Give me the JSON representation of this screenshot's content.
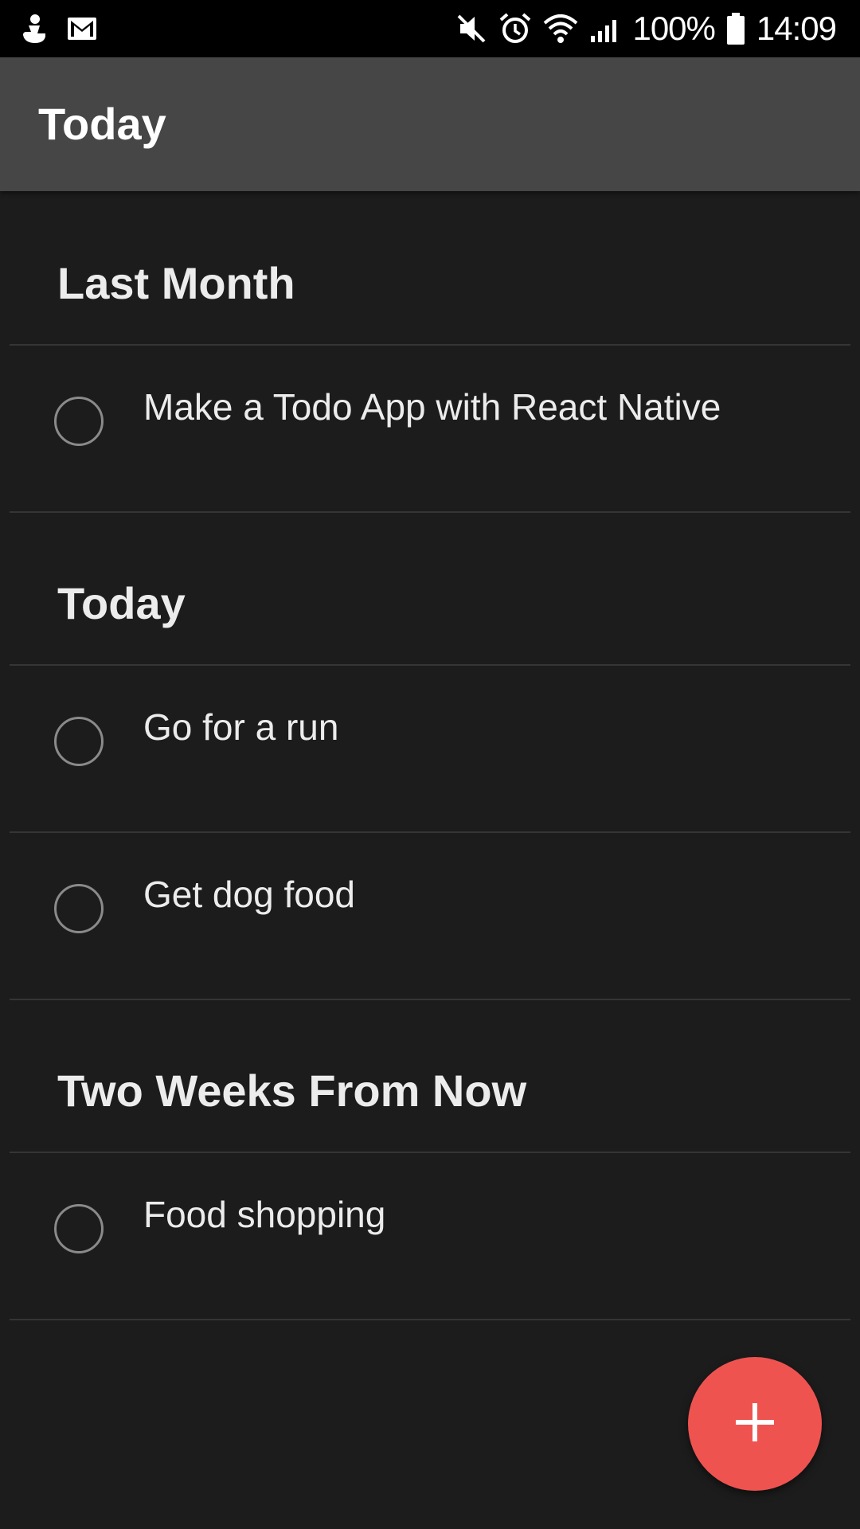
{
  "status_bar": {
    "battery_text": "100%",
    "time": "14:09",
    "left_icons": [
      "notification-icon",
      "gmail-icon"
    ],
    "right_icons": [
      "mute-icon",
      "alarm-icon",
      "wifi-icon",
      "signal-icon",
      "battery-icon"
    ]
  },
  "app_bar": {
    "title": "Today"
  },
  "sections": [
    {
      "title": "Last Month",
      "items": [
        {
          "label": "Make a Todo App with React Native",
          "done": false
        }
      ]
    },
    {
      "title": "Today",
      "items": [
        {
          "label": "Go for a run",
          "done": false
        },
        {
          "label": "Get dog food",
          "done": false
        }
      ]
    },
    {
      "title": "Two Weeks From Now",
      "items": [
        {
          "label": "Food shopping",
          "done": false
        }
      ]
    }
  ],
  "fab": {
    "icon": "plus-icon",
    "color": "#ef5350"
  },
  "colors": {
    "background": "#1c1c1c",
    "app_bar": "#464646",
    "accent": "#ef5350"
  }
}
